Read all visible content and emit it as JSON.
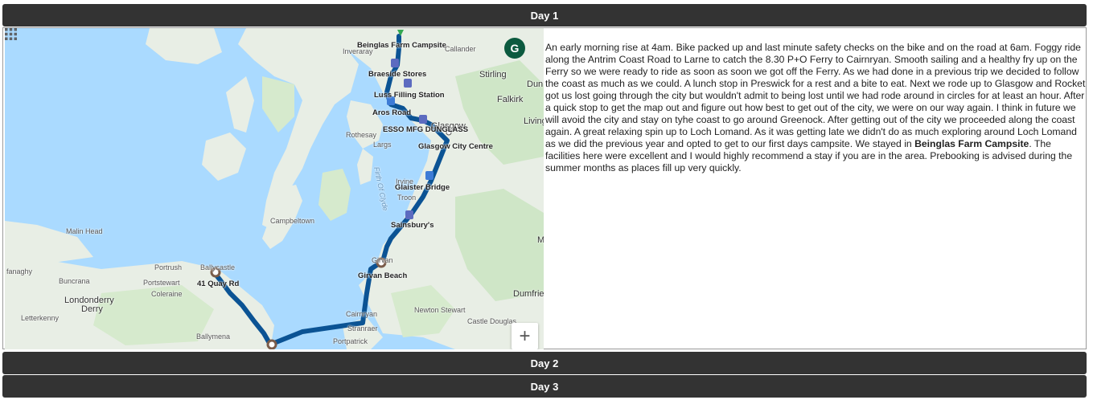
{
  "sections": {
    "day1": "Day 1",
    "day2": "Day 2",
    "day3": "Day 3"
  },
  "map": {
    "avatar_letter": "G",
    "apps_icon": "apps-grid-icon",
    "zoom_in_label": "+",
    "route_color": "#0b5394",
    "stops": {
      "beinglas": "Beinglas Farm Campsite",
      "braeside": "Braeside Stores",
      "luss": "Luss Filling Station",
      "aros": "Aros Road",
      "esso": "ESSO MFG DUNGLASS",
      "glasgow_centre": "Glasgow City Centre",
      "glaister": "Glaister Bridge",
      "sainsburys": "Sainsbury's",
      "girvan": "Girvan Beach",
      "quay": "41 Quay Rd"
    },
    "places": {
      "inveraray": "Inveraray",
      "callander": "Callander",
      "stirling": "Stirling",
      "dun": "Dun",
      "falkirk": "Falkirk",
      "living": "Living",
      "rothesay": "Rothesay",
      "largs": "Largs",
      "glasgow": "Glasgow",
      "irvine": "Irvine",
      "troon": "Troon",
      "campbeltown": "Campbeltown",
      "malin_head": "Malin Head",
      "portrush": "Portrush",
      "ballycastle": "Ballycastle",
      "buncrana": "Buncrana",
      "portstewart": "Portstewart",
      "coleraine": "Coleraine",
      "londonderry": "Londonderry",
      "derry": "Derry",
      "letterkenny": "Letterkenny",
      "ballymena": "Ballymena",
      "cairnryan": "Cairnryan",
      "stranraer": "Stranraer",
      "portpatrick": "Portpatrick",
      "newton_stewart": "Newton Stewart",
      "castle_douglas": "Castle Douglas",
      "dumfries": "Dumfrie",
      "fanaghy": "fanaghy",
      "firth": "Firth Of Clyde",
      "girvan": "Girvan",
      "m": "M"
    }
  },
  "entry": {
    "text_before": "An early morning rise at 4am. Bike packed up and last minute safety checks on the bike and on the road at 6am. Foggy ride along the Antrim Coast Road to Larne to catch the 8.30 P+O Ferry to Cairnryan. Smooth sailing and a healthy fry up on the Ferry so we were ready to ride as soon as soon we got off the Ferry. As we had done in a previous trip we decided to follow the coast as much as we could. A lunch stop in Preswick for a rest and a bite to eat. Next we rode up to Glasgow and Rocket got us lost going through the city but wouldn't admit to being lost until we had rode around in circles for at least an hour. After a quick stop to get the map out and figure out how best to get out of the city, we were on our way again. I think in future we will avoid the city and stay on tyhe coast to go around Greenock. After getting out of the city we proceeded along the coast again. A great relaxing spin up to Loch Lomand. As it was getting late we didn't do as much exploring around Loch Lomand as we did the previous year and opted to get to our first days campsite. We stayed in ",
    "campsite_name": "Beinglas Farm Campsite",
    "text_after": ". The facilities here were excellent and I would highly recommend a stay if you are in the area. Prebooking is advised during the summer months as places fill up very quickly."
  }
}
